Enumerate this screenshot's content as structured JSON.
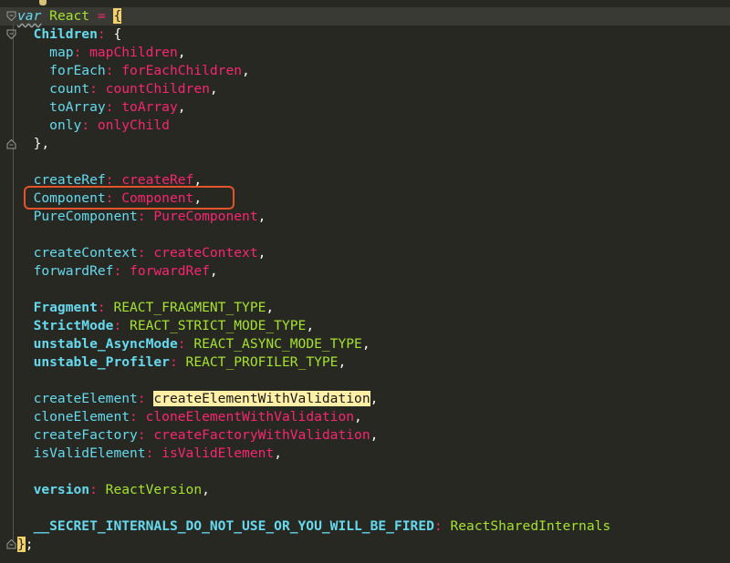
{
  "code": {
    "line1": {
      "kw": "var",
      "name": "React",
      "eq": " = ",
      "brace": "{"
    },
    "children": {
      "key": "Children",
      "sep": ": ",
      "open": "{"
    },
    "children_items": [
      {
        "key": "map",
        "sep": ": ",
        "val": "mapChildren",
        "end": ","
      },
      {
        "key": "forEach",
        "sep": ": ",
        "val": "forEachChildren",
        "end": ","
      },
      {
        "key": "count",
        "sep": ": ",
        "val": "countChildren",
        "end": ","
      },
      {
        "key": "toArray",
        "sep": ": ",
        "val": "toArray",
        "end": ","
      },
      {
        "key": "only",
        "sep": ": ",
        "val": "onlyChild",
        "end": ""
      }
    ],
    "children_close": "},",
    "createRef": {
      "key": "createRef",
      "sep": ": ",
      "val": "createRef",
      "end": ","
    },
    "component": {
      "key": "Component",
      "sep": ": ",
      "val": "Component",
      "end": ","
    },
    "pureComponent": {
      "key": "PureComponent",
      "sep": ": ",
      "val": "PureComponent",
      "end": ","
    },
    "createContext": {
      "key": "createContext",
      "sep": ": ",
      "val": "createContext",
      "end": ","
    },
    "forwardRef": {
      "key": "forwardRef",
      "sep": ": ",
      "val": "forwardRef",
      "end": ","
    },
    "fragment": {
      "key": "Fragment",
      "sep": ": ",
      "val": "REACT_FRAGMENT_TYPE",
      "end": ","
    },
    "strictMode": {
      "key": "StrictMode",
      "sep": ": ",
      "val": "REACT_STRICT_MODE_TYPE",
      "end": ","
    },
    "asyncMode": {
      "key": "unstable_AsyncMode",
      "sep": ": ",
      "val": "REACT_ASYNC_MODE_TYPE",
      "end": ","
    },
    "profiler": {
      "key": "unstable_Profiler",
      "sep": ": ",
      "val": "REACT_PROFILER_TYPE",
      "end": ","
    },
    "createElement": {
      "key": "createElement",
      "sep": ": ",
      "val": "createElementWithValidation",
      "end": ","
    },
    "cloneElement": {
      "key": "cloneElement",
      "sep": ": ",
      "val": "cloneElementWithValidation",
      "end": ","
    },
    "createFactory": {
      "key": "createFactory",
      "sep": ": ",
      "val": "createFactoryWithValidation",
      "end": ","
    },
    "isValidElement": {
      "key": "isValidElement",
      "sep": ": ",
      "val": "isValidElement",
      "end": ","
    },
    "version": {
      "key": "version",
      "sep": ": ",
      "val": "ReactVersion",
      "end": ","
    },
    "secret": {
      "key": "__SECRET_INTERNALS_DO_NOT_USE_OR_YOU_WILL_BE_FIRED",
      "sep": ": ",
      "val": "ReactSharedInternals"
    },
    "close": {
      "brace": "}",
      "semi": ";"
    }
  },
  "colors": {
    "background": "#272822",
    "keyword": "#66d9ef",
    "value": "#f92672",
    "constant": "#a6e22e",
    "annotation": "#e4542a",
    "highlight": "#fff0a5"
  },
  "icons": [
    "fold-open-icon",
    "fold-close-icon",
    "lightbulb-icon"
  ]
}
